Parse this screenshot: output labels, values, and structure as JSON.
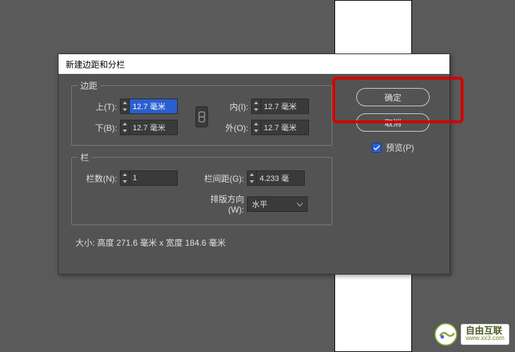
{
  "dialog": {
    "title": "新建边距和分栏",
    "ok_label": "确定",
    "cancel_label": "取消",
    "preview_label": "预览(P)",
    "preview_checked": true
  },
  "margins": {
    "legend": "边距",
    "top_label": "上(T):",
    "top_value": "12.7 毫米",
    "bottom_label": "下(B):",
    "bottom_value": "12.7 毫米",
    "inside_label": "内(I):",
    "inside_value": "12.7 毫米",
    "outside_label": "外(O):",
    "outside_value": "12.7 毫米"
  },
  "columns": {
    "legend": "栏",
    "count_label": "栏数(N):",
    "count_value": "1",
    "gutter_label": "栏间距(G):",
    "gutter_value": "4.233 毫",
    "direction_label": "排版方向(W):",
    "direction_value": "水平"
  },
  "size_info": "大小: 高度 271.6 毫米 x 宽度 184.6 毫米",
  "watermark": {
    "line1": "自由互联",
    "line2": "www.xx3.com"
  }
}
